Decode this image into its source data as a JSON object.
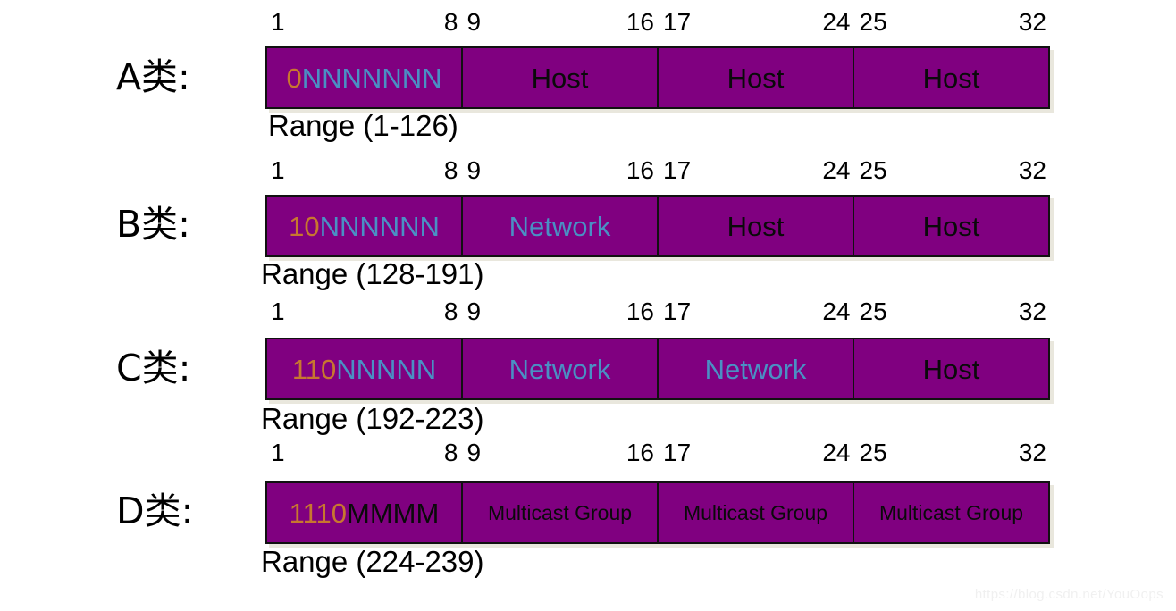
{
  "diagram": {
    "watermark": "https://blog.csdn.net/YouOops",
    "bar_color": "#800080",
    "blue_text_color": "#4a90c4",
    "orange_text_color": "#c8772f",
    "black_text_color": "#0a0a0a",
    "bit_ruler": [
      {
        "start": "1",
        "end": "8"
      },
      {
        "start": "9",
        "end": "16"
      },
      {
        "start": "17",
        "end": "24"
      },
      {
        "start": "25",
        "end": "32"
      }
    ],
    "classes": [
      {
        "label": "A类:",
        "range": "Range (1-126)",
        "octets": [
          {
            "prefix": "0",
            "prefix_color": "orange",
            "suffix": "NNNNNNN",
            "suffix_color": "blue",
            "size": "normal"
          },
          {
            "prefix": "",
            "prefix_color": "orange",
            "suffix": "Host",
            "suffix_color": "black",
            "size": "normal"
          },
          {
            "prefix": "",
            "prefix_color": "orange",
            "suffix": "Host",
            "suffix_color": "black",
            "size": "normal"
          },
          {
            "prefix": "",
            "prefix_color": "orange",
            "suffix": "Host",
            "suffix_color": "black",
            "size": "normal"
          }
        ]
      },
      {
        "label": "B类:",
        "range": "Range (128-191)",
        "octets": [
          {
            "prefix": "10",
            "prefix_color": "orange",
            "suffix": "NNNNNN",
            "suffix_color": "blue",
            "size": "normal"
          },
          {
            "prefix": "",
            "prefix_color": "orange",
            "suffix": "Network",
            "suffix_color": "blue",
            "size": "normal"
          },
          {
            "prefix": "",
            "prefix_color": "orange",
            "suffix": "Host",
            "suffix_color": "black",
            "size": "normal"
          },
          {
            "prefix": "",
            "prefix_color": "orange",
            "suffix": "Host",
            "suffix_color": "black",
            "size": "normal"
          }
        ]
      },
      {
        "label": "C类:",
        "range": "Range (192-223)",
        "octets": [
          {
            "prefix": "110",
            "prefix_color": "orange",
            "suffix": "NNNNN",
            "suffix_color": "blue",
            "size": "normal"
          },
          {
            "prefix": "",
            "prefix_color": "orange",
            "suffix": "Network",
            "suffix_color": "blue",
            "size": "normal"
          },
          {
            "prefix": "",
            "prefix_color": "orange",
            "suffix": "Network",
            "suffix_color": "blue",
            "size": "normal"
          },
          {
            "prefix": "",
            "prefix_color": "orange",
            "suffix": "Host",
            "suffix_color": "black",
            "size": "normal"
          }
        ]
      },
      {
        "label": "D类:",
        "range": "Range (224-239)",
        "octets": [
          {
            "prefix": "1110",
            "prefix_color": "orange",
            "suffix": "MMMM",
            "suffix_color": "black",
            "size": "normal"
          },
          {
            "prefix": "",
            "prefix_color": "orange",
            "suffix": "Multicast Group",
            "suffix_color": "black",
            "size": "small"
          },
          {
            "prefix": "",
            "prefix_color": "orange",
            "suffix": "Multicast Group",
            "suffix_color": "black",
            "size": "small"
          },
          {
            "prefix": "",
            "prefix_color": "orange",
            "suffix": "Multicast Group",
            "suffix_color": "black",
            "size": "small"
          }
        ]
      }
    ]
  }
}
